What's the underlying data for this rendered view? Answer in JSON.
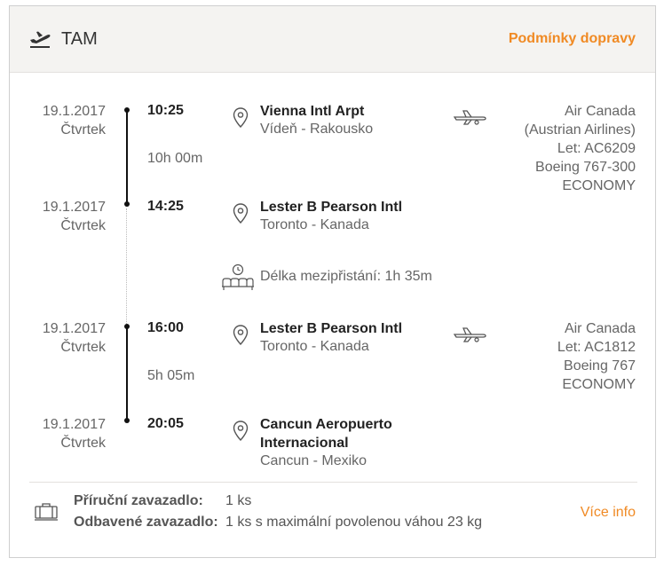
{
  "header": {
    "carrier": "TAM",
    "terms_link": "Podmínky dopravy"
  },
  "segments": [
    {
      "departure": {
        "date": "19.1.2017",
        "weekday": "Čtvrtek",
        "time": "10:25",
        "airport": "Vienna Intl Arpt",
        "city": "Vídeň - Rakousko"
      },
      "duration": "10h 00m",
      "arrival": {
        "date": "19.1.2017",
        "weekday": "Čtvrtek",
        "time": "14:25",
        "airport": "Lester B Pearson Intl",
        "city": "Toronto - Kanada"
      },
      "info": [
        "Air Canada",
        "(Austrian Airlines)",
        "Let: AC6209",
        "Boeing 767-300",
        "ECONOMY"
      ]
    },
    {
      "departure": {
        "date": "19.1.2017",
        "weekday": "Čtvrtek",
        "time": "16:00",
        "airport": "Lester B Pearson Intl",
        "city": "Toronto - Kanada"
      },
      "duration": "5h 05m",
      "arrival": {
        "date": "19.1.2017",
        "weekday": "Čtvrtek",
        "time": "20:05",
        "airport_line1": "Cancun Aeropuerto",
        "airport_line2": "Internacional",
        "city": "Cancun - Mexiko"
      },
      "info": [
        "Air Canada",
        "Let: AC1812",
        "Boeing 767",
        "ECONOMY"
      ]
    }
  ],
  "layover": {
    "text": "Délka mezipřistání: 1h 35m"
  },
  "baggage": {
    "carry_on_label": "Příruční zavazadlo:",
    "carry_on_value": "1 ks",
    "checked_label": "Odbavené zavazadlo:",
    "checked_value": "1 ks s maximální povolenou váhou 23 kg",
    "more_info": "Více info"
  },
  "colors": {
    "accent": "#f08a24",
    "header_bg": "#f4f3f1"
  },
  "icons": {
    "header": "plane-departure-icon",
    "pin": "map-pin-icon",
    "flight": "airplane-icon",
    "layover": "waiting-seats-clock-icon",
    "baggage": "suitcase-icon"
  }
}
